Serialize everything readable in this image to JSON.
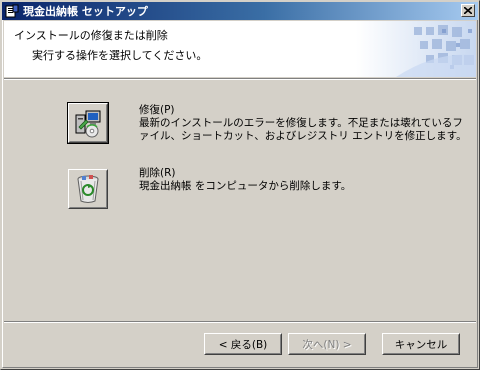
{
  "window": {
    "title": "現金出納帳 セットアップ",
    "close_label": "×"
  },
  "header": {
    "title": "インストールの修復または削除",
    "subtitle": "実行する操作を選択してください。"
  },
  "options": [
    {
      "label": "修復(P)",
      "description_line1": "最新のインストールのエラーを修復します。不足または壊れているフ",
      "description_line2": "ァイル、ショートカット、およびレジストリ エントリを修正します。",
      "icon": "repair-icon"
    },
    {
      "label": "削除(R)",
      "description_line1": "現金出納帳 をコンピュータから削除します。",
      "icon": "recycle-bin-icon"
    }
  ],
  "footer": {
    "back_label": "< 戻る(B)",
    "next_label": "次へ(N) >",
    "cancel_label": "キャンセル",
    "next_enabled": false
  }
}
